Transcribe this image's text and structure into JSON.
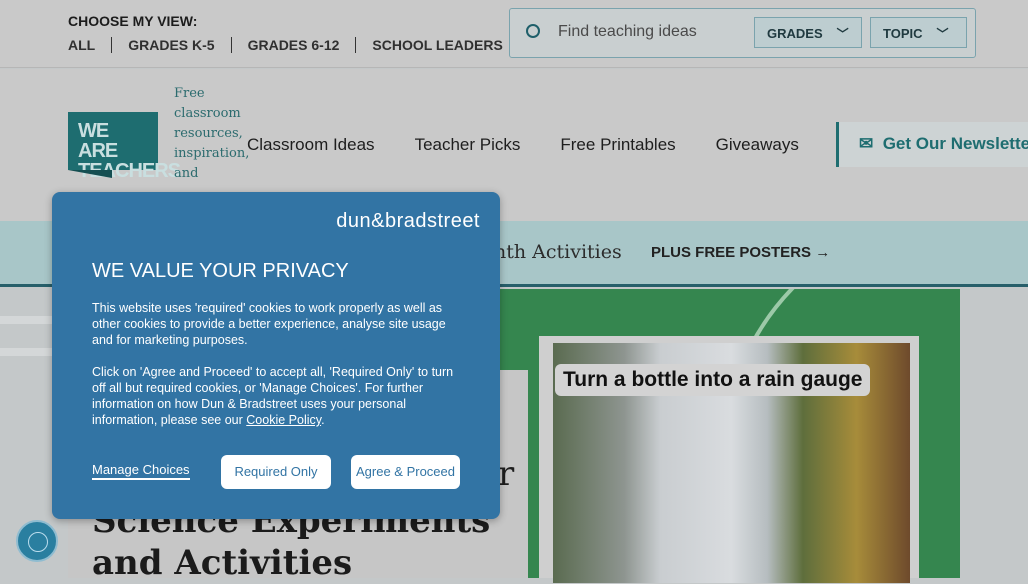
{
  "topbar": {
    "choose_label": "CHOOSE MY VIEW:",
    "views": [
      "ALL",
      "GRADES K-5",
      "GRADES 6-12",
      "SCHOOL LEADERS"
    ],
    "search": {
      "placeholder": "Find teaching ideas",
      "grades": "GRADES",
      "topic": "TOPIC"
    }
  },
  "nav": {
    "logo": "WE ARE TEACHERS",
    "tagline": "Free classroom resources, inspiration, and",
    "links": [
      "Classroom Ideas",
      "Teacher Picks",
      "Free Printables",
      "Giveaways"
    ],
    "newsletter": "Get Our Newsletter"
  },
  "strip": {
    "text": "nth Activities",
    "posters": "PLUS FREE POSTERS →"
  },
  "article": {
    "title_partial": "r",
    "title": "Science Experiments and Activities",
    "caption": "Turn a bottle into a rain gauge"
  },
  "popup": {
    "brand": "dun&bradstreet",
    "title": "WE VALUE YOUR PRIVACY",
    "p1": "This website uses 'required' cookies to work properly as well as other cookies to provide a better experience, analyse site usage and for marketing purposes.",
    "p2": "Click on 'Agree and Proceed' to accept all, 'Required Only' to turn off all but required cookies, or 'Manage Choices'. For further information on how Dun & Bradstreet uses your personal information, please see our",
    "cookie_policy": "Cookie Policy",
    "manage": "Manage Choices",
    "required": "Required Only",
    "agree": "Agree & Proceed"
  },
  "colors": {
    "popup": "#3274a4",
    "brand_teal": "#1e6d70",
    "green": "#35864f"
  }
}
